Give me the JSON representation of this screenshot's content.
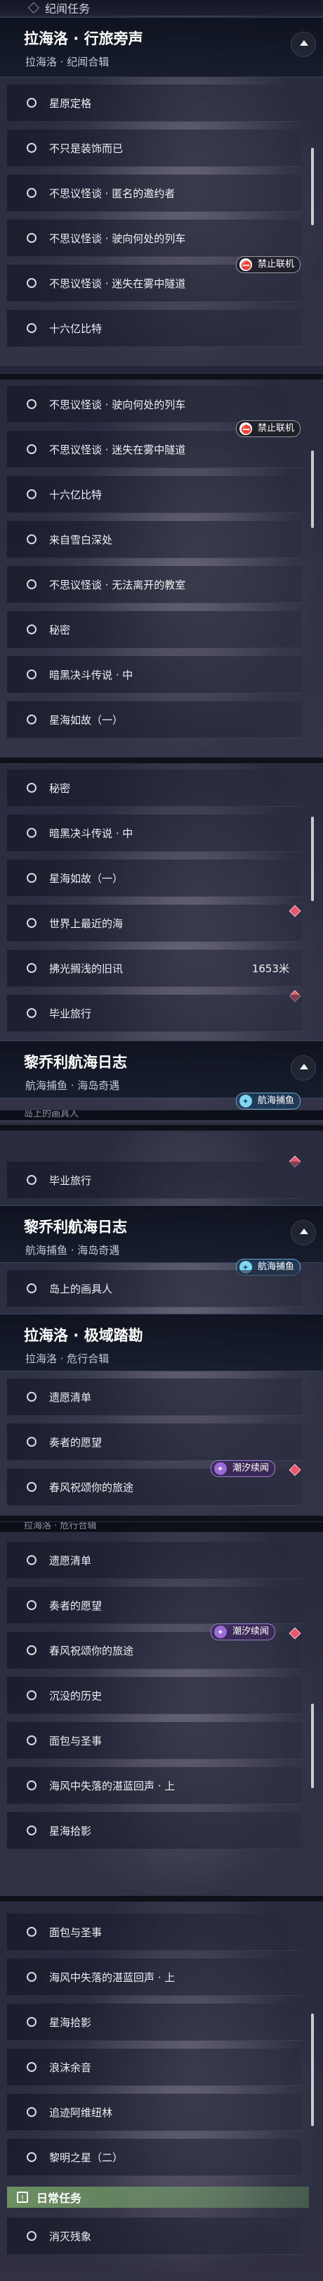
{
  "crumb": {
    "label": "纪闻任务"
  },
  "panel1": {
    "title": "拉海洛 · 行旅旁声",
    "subtitle": "拉海洛 · 纪闻合辑",
    "items": [
      "星原定格",
      "不只是装饰而已",
      "不思议怪谈 · 匿名的邀约者",
      "不思议怪谈 · 驶向何处的列车",
      "不思议怪谈 · 迷失在雾中隧道",
      "十六亿比特"
    ],
    "tag": "禁止联机"
  },
  "panel2": {
    "items": [
      "不思议怪谈 · 驶向何处的列车",
      "不思议怪谈 · 迷失在雾中隧道",
      "十六亿比特",
      "来自雪白深处",
      "不思议怪谈 · 无法离开的教室",
      "秘密",
      "暗黑决斗传说 · 中",
      "星海如故（一）"
    ],
    "tag": "禁止联机"
  },
  "panel3": {
    "items": [
      "秘密",
      "暗黑决斗传说 · 中",
      "星海如故（一）",
      "世界上最近的海",
      "拂光搁浅的旧讯",
      "毕业旅行"
    ],
    "distance": "1653米",
    "header": {
      "title": "黎乔利航海日志",
      "subtitle": "航海捕鱼 · 海岛奇遇",
      "tag": "航海捕鱼"
    },
    "cut_item": "岛上的画具人"
  },
  "panel4": {
    "items": [
      "毕业旅行"
    ],
    "header": {
      "title": "黎乔利航海日志",
      "subtitle": "航海捕鱼 · 海岛奇遇",
      "tag": "航海捕鱼"
    },
    "items2": [
      "岛上的画具人"
    ],
    "header2": {
      "title": "拉海洛 · 极域踏勘",
      "subtitle": "拉海洛 · 危行合辑"
    },
    "items3": [
      "遗愿清单",
      "奏者的愿望",
      "春风祝颂你的旅途"
    ],
    "tag": "潮汐续闻"
  },
  "panel5": {
    "cut_header": "拉海洛 · 危行合辑",
    "items": [
      "遗愿清单",
      "奏者的愿望",
      "春风祝颂你的旅途",
      "沉没的历史",
      "面包与圣事",
      "海风中失落的湛蓝回声 · 上",
      "星海拾影"
    ],
    "tag": "潮汐续闻"
  },
  "panel6": {
    "items": [
      "面包与圣事",
      "海风中失落的湛蓝回声 · 上",
      "星海拾影",
      "浪沫余音",
      "追迹阿维纽林",
      "黎明之星（二）"
    ],
    "daily": {
      "label": "日常任务",
      "icon": "quest-book-icon"
    },
    "daily_items": [
      "消灭残象"
    ]
  }
}
